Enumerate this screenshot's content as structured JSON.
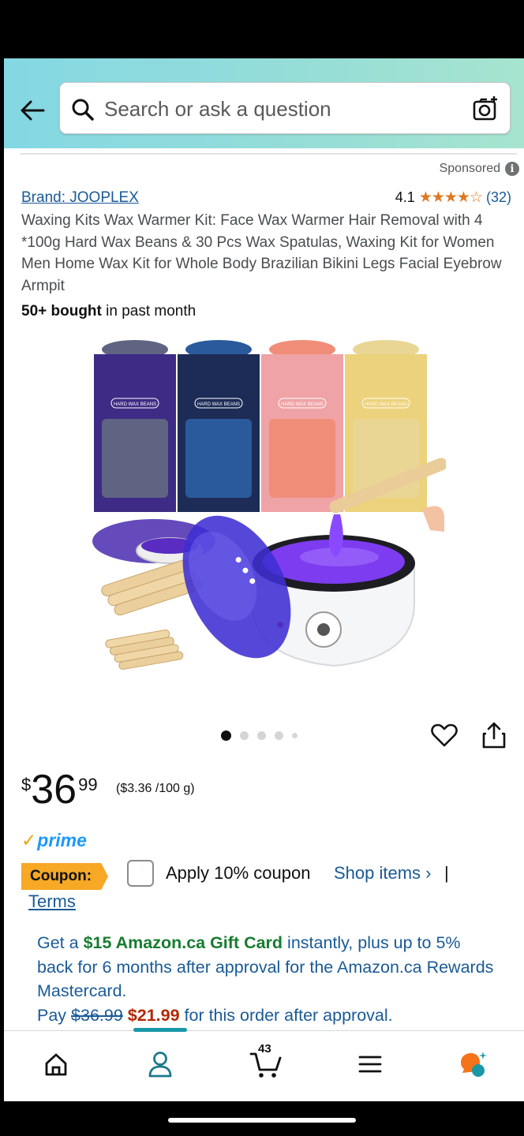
{
  "search": {
    "placeholder": "Search or ask a question"
  },
  "sponsored_label": "Sponsored",
  "product": {
    "brand_label": "Brand: JOOPLEX",
    "rating_value": "4.1",
    "rating_stars": 4.1,
    "rating_count": "(32)",
    "title": "Waxing Kits Wax Warmer Kit: Face Wax Warmer Hair Removal with 4 *100g Hard Wax Beans & 30 Pcs Wax Spatulas, Waxing Kit for Women Men Home Wax Kit for Whole Body Brazilian Bikini Legs Facial Eyebrow Armpit",
    "bought_count": "50+ bought",
    "bought_suffix": " in past month",
    "bag_label": "HARD WAX BEANS",
    "bag_colors": [
      "#3e2b85",
      "#1d2c57",
      "#efa3a6",
      "#ecd27c"
    ],
    "bead_colors": [
      "#5f6483",
      "#2a5a9c",
      "#f08d78",
      "#e9d695"
    ],
    "carousel_total": 5,
    "carousel_active": 0
  },
  "price": {
    "symbol": "$",
    "whole": "36",
    "fraction": "99",
    "unit_price": "($3.36 /100 g)"
  },
  "prime_label": "prime",
  "coupon": {
    "badge": "Coupon:",
    "text": "Apply 10% coupon",
    "shop_link": "Shop items ›",
    "separator": "|",
    "terms": "Terms"
  },
  "offer": {
    "part1": "Get a ",
    "highlight": "$15 Amazon.ca Gift Card",
    "part2": " instantly, plus up to 5% back for 6 months after approval for the Amazon.ca Rewards Mastercard.",
    "pay_label": "Pay ",
    "original_price": "$36.99",
    "discount_price": "$21.99",
    "pay_suffix": " for this order after approval."
  },
  "nav": {
    "cart_count": "43",
    "items": [
      "home",
      "account",
      "cart",
      "menu",
      "rufus"
    ]
  },
  "colors": {
    "link": "#1a5a96",
    "star": "#de7921",
    "coupon": "#f7a824",
    "prime": "#1a98ff",
    "accent": "#1a98a8"
  }
}
